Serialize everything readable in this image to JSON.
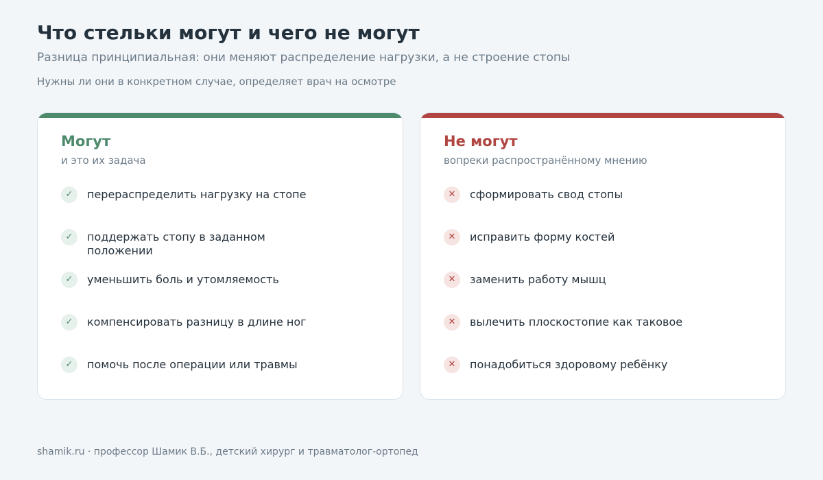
{
  "header": {
    "title": "Что стельки могут и чего не могут",
    "subtitle": "Разница принципиальная: они меняют распределение нагрузки, а не строение стопы",
    "note": "Нужны ли они в конкретном случае, определяет врач на осмотре"
  },
  "can": {
    "title": "Могут",
    "subtitle": "и это их задача",
    "icon": "check-icon",
    "color": "#4e8a6c",
    "items": [
      {
        "text": "перераспределить нагрузку на стопе"
      },
      {
        "text": "поддержать стопу в заданном положении"
      },
      {
        "text": "уменьшить боль и утомляемость"
      },
      {
        "text": "компенсировать разницу в длине ног"
      },
      {
        "text": "помочь после операции или травмы"
      }
    ]
  },
  "cannot": {
    "title": "Не могут",
    "subtitle": "вопреки распространённому мнению",
    "icon": "cross-icon",
    "color": "#b04541",
    "items": [
      {
        "text": "сформировать свод стопы"
      },
      {
        "text": "исправить форму костей"
      },
      {
        "text": "заменить работу мышц"
      },
      {
        "text": "вылечить плоскостопие как таковое"
      },
      {
        "text": "понадобиться здоровому ребёнку"
      }
    ]
  },
  "footer": {
    "text": "shamik.ru · профессор Шамик В.Б., детский хирург и травматолог-ортопед"
  }
}
